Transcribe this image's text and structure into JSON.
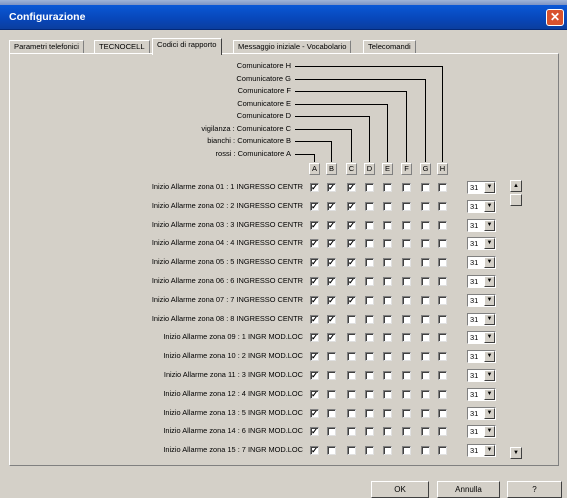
{
  "window": {
    "title": "Configurazione",
    "close_glyph": "✕"
  },
  "tabs": [
    {
      "label": "Parametri telefonici",
      "active": false
    },
    {
      "label": "TECNOCELL",
      "active": false
    },
    {
      "label": "Codici di rapporto",
      "active": true
    },
    {
      "label": "Messaggio iniziale - Vocabolario",
      "active": false
    },
    {
      "label": "Telecomandi",
      "active": false
    }
  ],
  "communicators": [
    "Comunicatore H",
    "Comunicatore G",
    "Comunicatore F",
    "Comunicatore E",
    "Comunicatore D",
    "vigilanza : Comunicatore C",
    "bianchi : Comunicatore B",
    "rossi : Comunicatore A"
  ],
  "columns": [
    "A",
    "B",
    "C",
    "D",
    "E",
    "F",
    "G",
    "H"
  ],
  "rows": [
    {
      "label": "Inizio Allarme zona 01 : 1 INGRESSO CENTR",
      "checks": [
        1,
        1,
        1,
        0,
        0,
        0,
        0,
        0
      ],
      "value": "31"
    },
    {
      "label": "Inizio Allarme zona 02 : 2 INGRESSO CENTR",
      "checks": [
        1,
        1,
        1,
        0,
        0,
        0,
        0,
        0
      ],
      "value": "31"
    },
    {
      "label": "Inizio Allarme zona 03 : 3 INGRESSO CENTR",
      "checks": [
        1,
        1,
        1,
        0,
        0,
        0,
        0,
        0
      ],
      "value": "31"
    },
    {
      "label": "Inizio Allarme zona 04 : 4 INGRESSO CENTR",
      "checks": [
        1,
        1,
        1,
        0,
        0,
        0,
        0,
        0
      ],
      "value": "31"
    },
    {
      "label": "Inizio Allarme zona 05 : 5 INGRESSO CENTR",
      "checks": [
        1,
        1,
        1,
        0,
        0,
        0,
        0,
        0
      ],
      "value": "31"
    },
    {
      "label": "Inizio Allarme zona 06 : 6 INGRESSO CENTR",
      "checks": [
        1,
        1,
        1,
        0,
        0,
        0,
        0,
        0
      ],
      "value": "31"
    },
    {
      "label": "Inizio Allarme zona 07 : 7 INGRESSO CENTR",
      "checks": [
        1,
        1,
        1,
        0,
        0,
        0,
        0,
        0
      ],
      "value": "31"
    },
    {
      "label": "Inizio Allarme zona 08 : 8 INGRESSO CENTR",
      "checks": [
        1,
        1,
        0,
        0,
        0,
        0,
        0,
        0
      ],
      "value": "31"
    },
    {
      "label": "Inizio Allarme zona 09 : 1 INGR MOD.LOC",
      "checks": [
        1,
        1,
        0,
        0,
        0,
        0,
        0,
        0
      ],
      "value": "31"
    },
    {
      "label": "Inizio Allarme zona 10 : 2 INGR MOD.LOC",
      "checks": [
        1,
        0,
        0,
        0,
        0,
        0,
        0,
        0
      ],
      "value": "31"
    },
    {
      "label": "Inizio Allarme zona 11 : 3 INGR MOD.LOC",
      "checks": [
        1,
        0,
        0,
        0,
        0,
        0,
        0,
        0
      ],
      "value": "31"
    },
    {
      "label": "Inizio Allarme zona 12 : 4 INGR MOD.LOC",
      "checks": [
        1,
        0,
        0,
        0,
        0,
        0,
        0,
        0
      ],
      "value": "31"
    },
    {
      "label": "Inizio Allarme zona 13 : 5 INGR MOD.LOC",
      "checks": [
        1,
        0,
        0,
        0,
        0,
        0,
        0,
        0
      ],
      "value": "31"
    },
    {
      "label": "Inizio Allarme zona 14 : 6 INGR MOD.LOC",
      "checks": [
        1,
        0,
        0,
        0,
        0,
        0,
        0,
        0
      ],
      "value": "31"
    },
    {
      "label": "Inizio Allarme zona 15 : 7 INGR MOD.LOC",
      "checks": [
        1,
        0,
        0,
        0,
        0,
        0,
        0,
        0
      ],
      "value": "31"
    }
  ],
  "scrollbar": {
    "up_glyph": "▲",
    "down_glyph": "▼"
  },
  "combo_arrow_glyph": "▼",
  "check_glyph": "✓",
  "buttons": {
    "ok": "OK",
    "cancel": "Annulla",
    "help": "?"
  }
}
